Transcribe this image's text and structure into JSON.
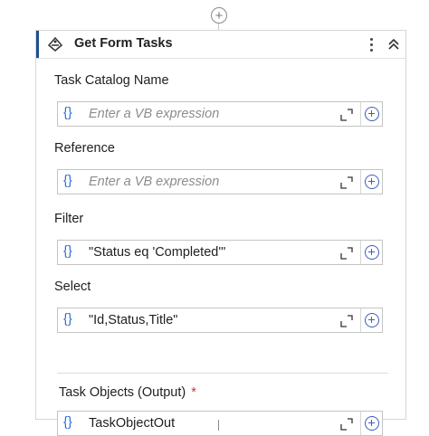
{
  "activity": {
    "title": "Get Form Tasks"
  },
  "fields": [
    {
      "label": "Task Catalog Name",
      "value": "Enter a VB expression",
      "is_placeholder": true
    },
    {
      "label": "Reference",
      "value": "Enter a VB expression",
      "is_placeholder": true
    },
    {
      "label": "Filter",
      "value": "\"Status eq 'Completed'\"",
      "is_placeholder": false
    },
    {
      "label": "Select",
      "value": "\"Id,Status,Title\"",
      "is_placeholder": false
    }
  ],
  "output_section": {
    "label": "Task Objects (Output)",
    "required_marker": "*",
    "value": "TaskObjectOut"
  },
  "expression_symbol": "{}",
  "colors": {
    "accent": "#1d4f91",
    "brace": "#2b6bd6",
    "required": "#d13438"
  },
  "icons": [
    "add-activity-icon",
    "activity-type-icon",
    "more-options-icon",
    "collapse-icon",
    "expression-icon",
    "expand-editor-icon",
    "add-variable-icon"
  ]
}
